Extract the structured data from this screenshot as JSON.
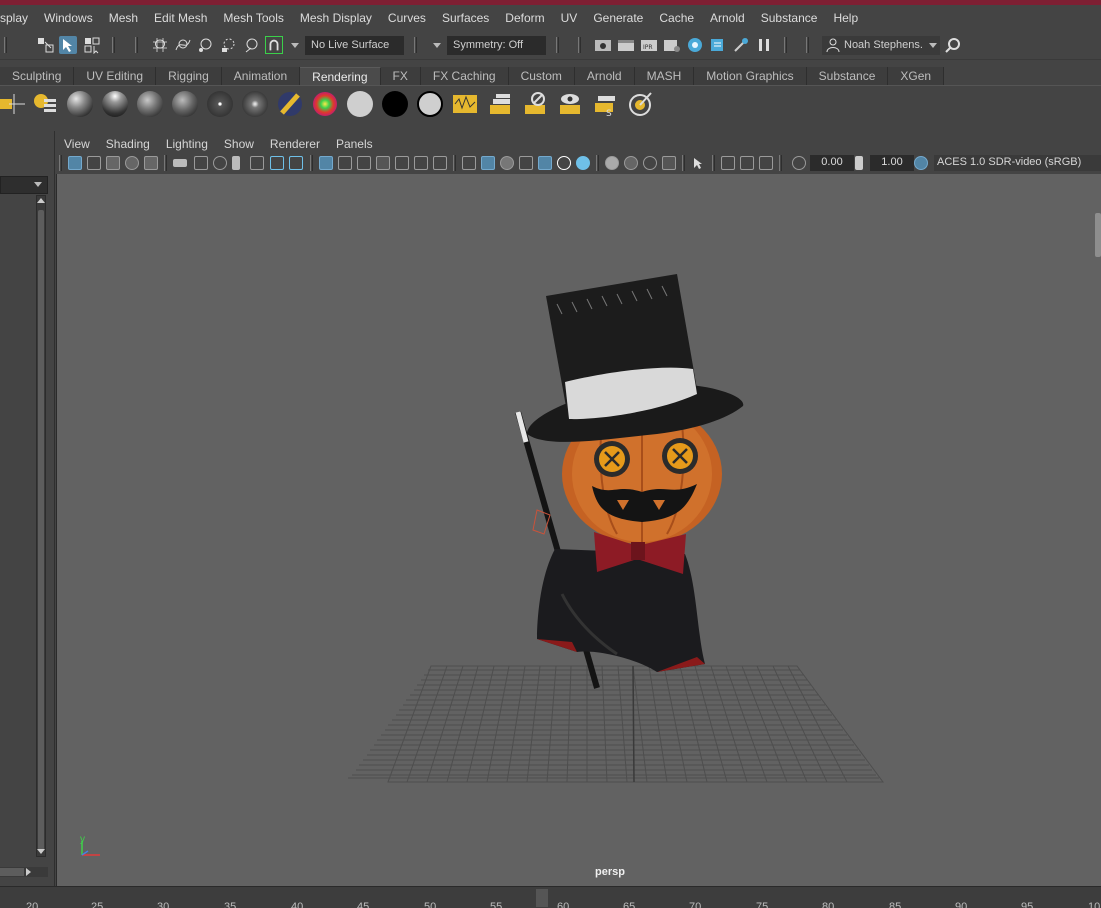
{
  "menu": [
    "splay",
    "Windows",
    "Mesh",
    "Edit Mesh",
    "Mesh Tools",
    "Mesh Display",
    "Curves",
    "Surfaces",
    "Deform",
    "UV",
    "Generate",
    "Cache",
    "Arnold",
    "Substance",
    "Help"
  ],
  "status": {
    "live_surface": "No Live Surface",
    "symmetry": "Symmetry: Off",
    "user": "Noah Stephens."
  },
  "shelf_tabs": [
    "Sculpting",
    "UV Editing",
    "Rigging",
    "Animation",
    "Rendering",
    "FX",
    "FX Caching",
    "Custom",
    "Arnold",
    "MASH",
    "Motion Graphics",
    "Substance",
    "XGen"
  ],
  "active_shelf_tab": "Rendering",
  "panel_menu": [
    "View",
    "Shading",
    "Lighting",
    "Show",
    "Renderer",
    "Panels"
  ],
  "panel_toolbar": {
    "exposure": "0.00",
    "gamma": "1.00",
    "color_space": "ACES 1.0 SDR-video (sRGB)"
  },
  "viewport": {
    "camera": "persp",
    "axis_y": "y"
  },
  "timeline_ticks": [
    "20",
    "25",
    "30",
    "35",
    "40",
    "45",
    "50",
    "55",
    "60",
    "65",
    "70",
    "75",
    "80",
    "85",
    "90",
    "95",
    "10"
  ]
}
